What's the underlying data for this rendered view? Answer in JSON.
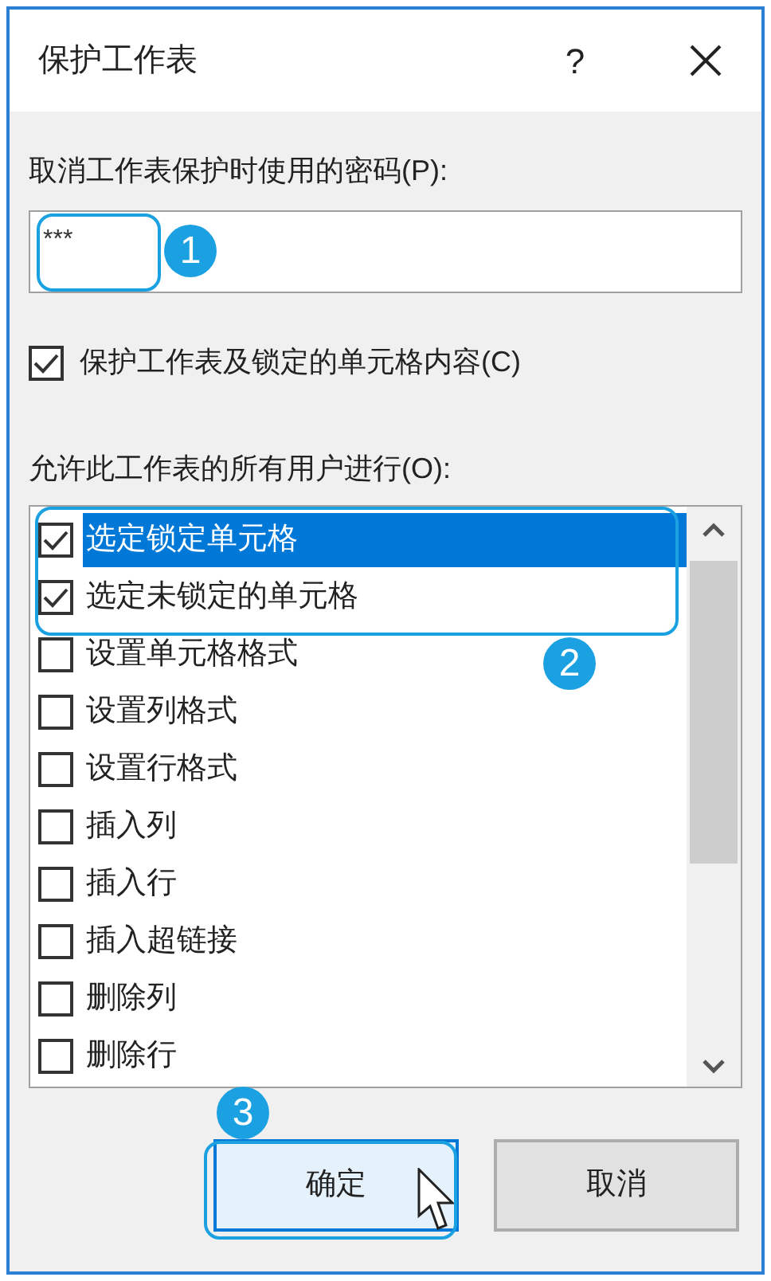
{
  "window": {
    "title": "保护工作表",
    "help": "?"
  },
  "password": {
    "label": "取消工作表保护时使用的密码(P):",
    "value": "***"
  },
  "protect_contents": {
    "label": "保护工作表及锁定的单元格内容(C)",
    "checked": true
  },
  "permissions": {
    "label": "允许此工作表的所有用户进行(O):",
    "items": [
      {
        "label": "选定锁定单元格",
        "checked": true,
        "selected": true
      },
      {
        "label": "选定未锁定的单元格",
        "checked": true,
        "selected": false
      },
      {
        "label": "设置单元格格式",
        "checked": false,
        "selected": false
      },
      {
        "label": "设置列格式",
        "checked": false,
        "selected": false
      },
      {
        "label": "设置行格式",
        "checked": false,
        "selected": false
      },
      {
        "label": "插入列",
        "checked": false,
        "selected": false
      },
      {
        "label": "插入行",
        "checked": false,
        "selected": false
      },
      {
        "label": "插入超链接",
        "checked": false,
        "selected": false
      },
      {
        "label": "删除列",
        "checked": false,
        "selected": false
      },
      {
        "label": "删除行",
        "checked": false,
        "selected": false
      }
    ]
  },
  "buttons": [
    {
      "label": "确定",
      "kind": "default"
    },
    {
      "label": "取消",
      "kind": "normal"
    }
  ],
  "annotations": [
    {
      "label": "1"
    },
    {
      "label": "2"
    },
    {
      "label": "3"
    }
  ]
}
